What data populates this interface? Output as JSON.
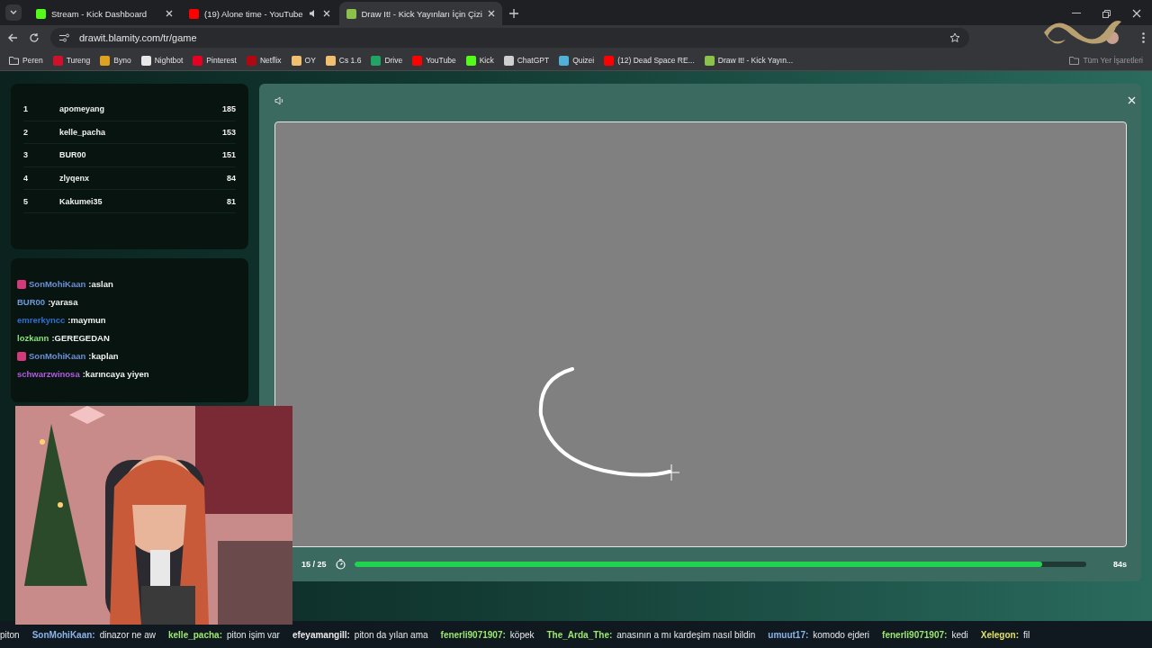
{
  "tabs": [
    {
      "title": "Stream - Kick Dashboard",
      "selected": false,
      "color": "#53fc18",
      "audio": false
    },
    {
      "title": "(19) Alone time - YouTube",
      "selected": false,
      "color": "#ff0000",
      "audio": true
    },
    {
      "title": "Draw It! - Kick Yayınları İçin Çizi",
      "selected": true,
      "color": "#8bc34a",
      "audio": false
    }
  ],
  "url": "drawit.blamity.com/tr/game",
  "bookmarks": [
    {
      "label": "Peren",
      "kind": "folder"
    },
    {
      "label": "Tureng",
      "kind": "site",
      "color": "#d0112b"
    },
    {
      "label": "Byno",
      "kind": "site",
      "color": "#e0a020"
    },
    {
      "label": "Nightbot",
      "kind": "site",
      "color": "#e8e8e8"
    },
    {
      "label": "Pinterest",
      "kind": "site",
      "color": "#e60023"
    },
    {
      "label": "Netflix",
      "kind": "site",
      "color": "#b20710"
    },
    {
      "label": "OY",
      "kind": "site",
      "color": "#f0c070"
    },
    {
      "label": "Cs 1.6",
      "kind": "site",
      "color": "#f0c070"
    },
    {
      "label": "Drive",
      "kind": "site",
      "color": "#1fa463"
    },
    {
      "label": "YouTube",
      "kind": "site",
      "color": "#ff0000"
    },
    {
      "label": "Kick",
      "kind": "site",
      "color": "#53fc18"
    },
    {
      "label": "ChatGPT",
      "kind": "site",
      "color": "#cfcfcf"
    },
    {
      "label": "Quizei",
      "kind": "site",
      "color": "#4fb0d8"
    },
    {
      "label": "(12) Dead Space RE...",
      "kind": "site",
      "color": "#ff0000"
    },
    {
      "label": "Draw It! - Kick Yayın...",
      "kind": "site",
      "color": "#8bc34a"
    }
  ],
  "all_bookmarks": "Tüm Yer İşaretleri",
  "leaderboard": [
    {
      "rank": "1",
      "name": "apomeyang",
      "score": "185"
    },
    {
      "rank": "2",
      "name": "kelle_pacha",
      "score": "153"
    },
    {
      "rank": "3",
      "name": "BUR00",
      "score": "151"
    },
    {
      "rank": "4",
      "name": "zlyqenx",
      "score": "84"
    },
    {
      "rank": "5",
      "name": "Kakumei35",
      "score": "81"
    }
  ],
  "chat": [
    {
      "user": "SonMohiKaan",
      "color": "#6b8fd6",
      "badge": true,
      "text": ":aslan"
    },
    {
      "user": "BUR00",
      "color": "#6b9be0",
      "badge": false,
      "text": ":yarasa"
    },
    {
      "user": "emrerkyncc",
      "color": "#2f6fd0",
      "badge": false,
      "text": ":maymun"
    },
    {
      "user": "lozkann",
      "color": "#8be07a",
      "badge": false,
      "text": ":GEREGEDAN"
    },
    {
      "user": "SonMohiKaan",
      "color": "#6b8fd6",
      "badge": true,
      "text": ":kaplan"
    },
    {
      "user": "schwarzwinosa",
      "color": "#b05ce0",
      "badge": false,
      "text": ":karıncaya yiyen"
    }
  ],
  "game": {
    "round": "15 / 25",
    "level": 0.94,
    "time": "84s"
  },
  "ticker_lead": "piton",
  "ticker": [
    {
      "user": "SonMohiKaan:",
      "color": "#8ab4e8",
      "text": "dinazor ne aw"
    },
    {
      "user": "kelle_pacha:",
      "color": "#9be86a",
      "text": "piton işim var"
    },
    {
      "user": "efeyamangill:",
      "color": "#e8e8e8",
      "text": "piton da yılan ama"
    },
    {
      "user": "fenerli9071907:",
      "color": "#9be86a",
      "text": "köpek"
    },
    {
      "user": "The_Arda_The:",
      "color": "#9be86a",
      "text": "anasının a mı kardeşim nasıl bildin"
    },
    {
      "user": "umuut17:",
      "color": "#8ab4e8",
      "text": "komodo ejderi"
    },
    {
      "user": "fenerli9071907:",
      "color": "#9be86a",
      "text": "kedi"
    },
    {
      "user": "Xelegon:",
      "color": "#e0e060",
      "text": "fil"
    }
  ]
}
